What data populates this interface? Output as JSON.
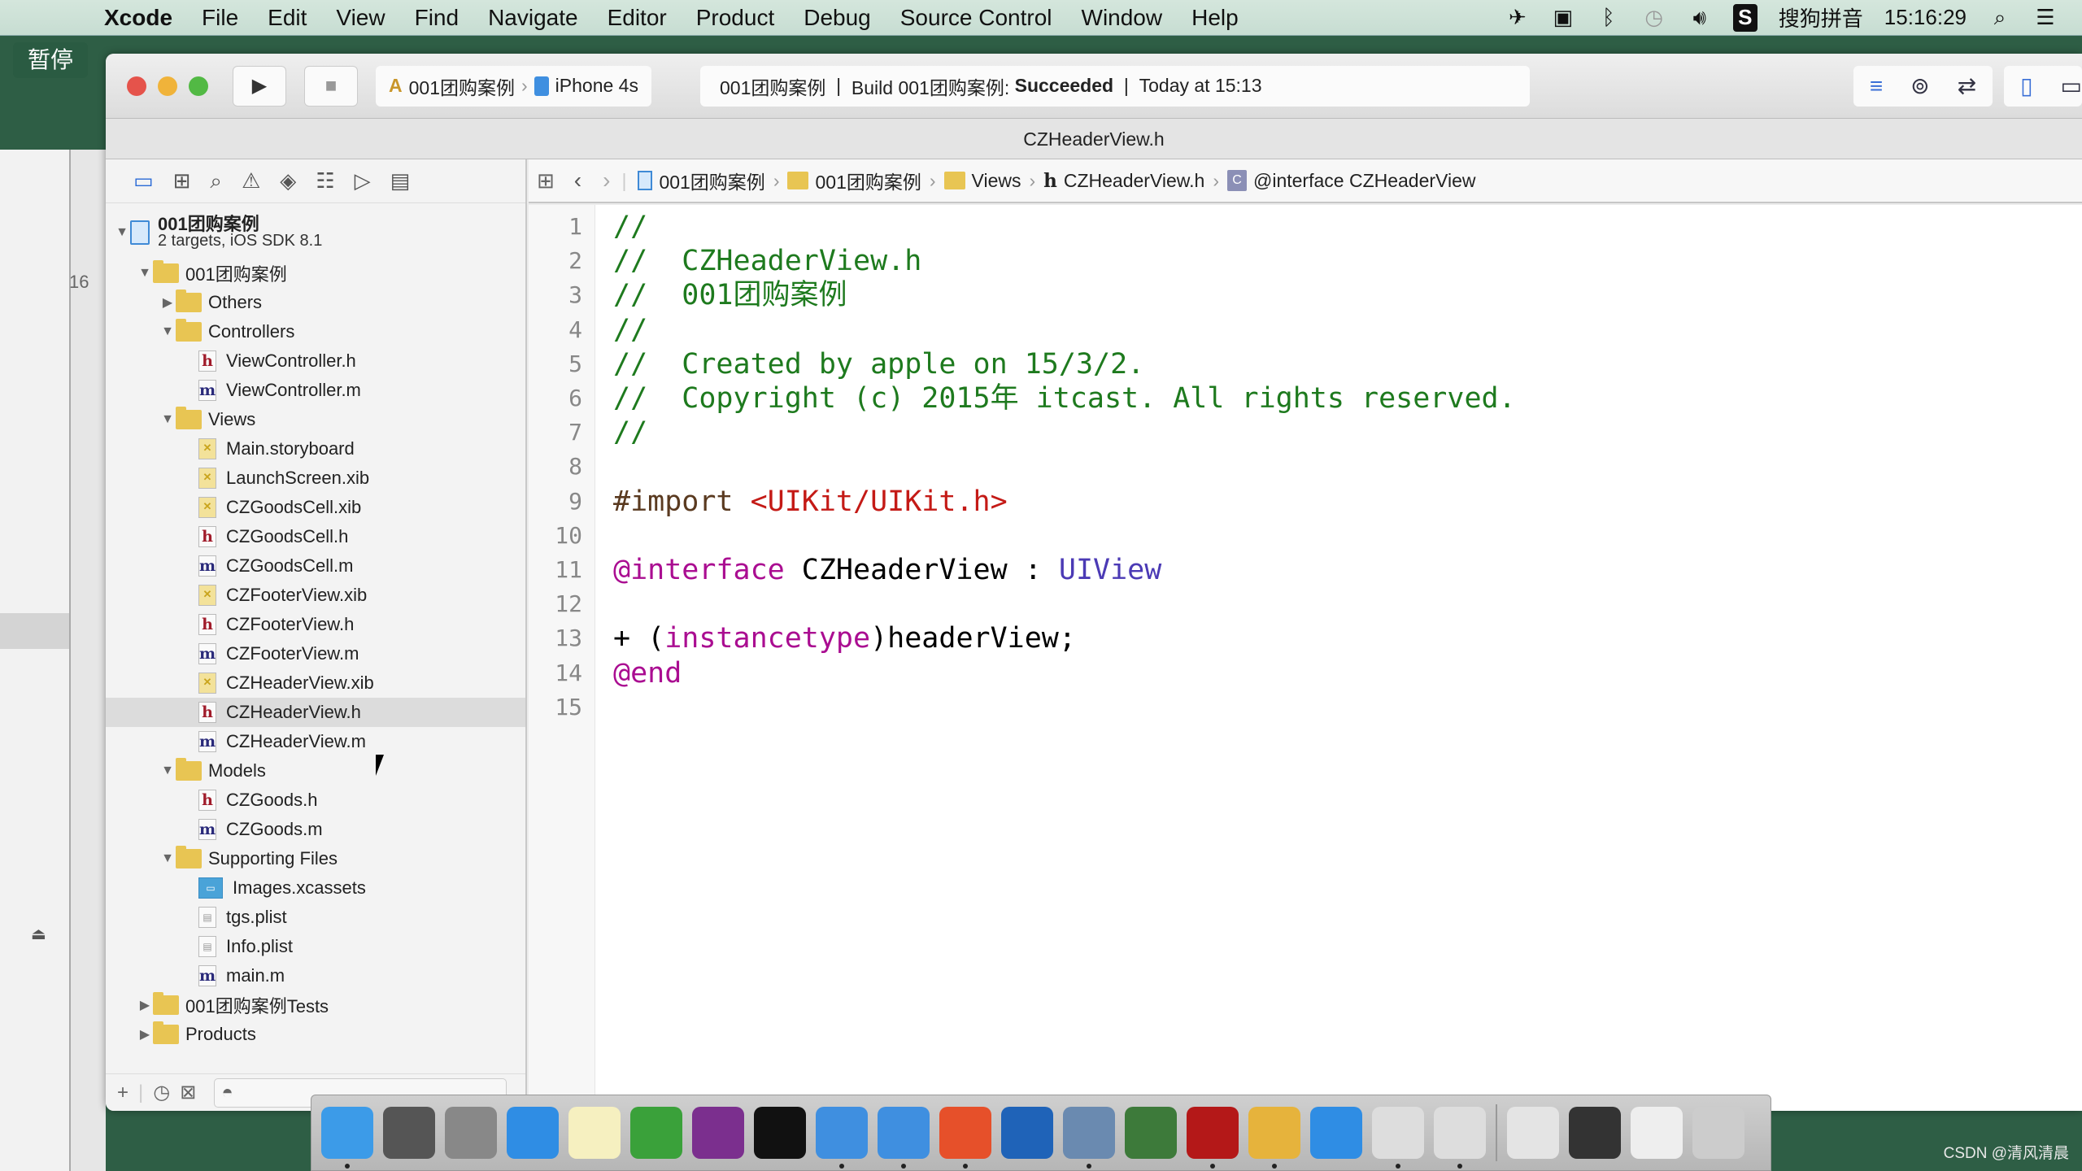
{
  "menubar": {
    "app": "Xcode",
    "items": [
      "File",
      "Edit",
      "View",
      "Find",
      "Navigate",
      "Editor",
      "Product",
      "Debug",
      "Source Control",
      "Window",
      "Help"
    ],
    "input_method": "搜狗拼音",
    "clock": "15:16:29",
    "status_icons": [
      "airplane-icon",
      "screen-record-icon",
      "bluetooth-icon",
      "time-machine-icon",
      "volume-icon",
      "sogou-icon",
      "spotlight-icon",
      "notification-center-icon"
    ]
  },
  "background": {
    "pause_label": "暂停",
    "line_number": "16"
  },
  "toolbar": {
    "scheme": "001团购案例",
    "device": "iPhone 4s",
    "activity": {
      "project": "001团购案例",
      "build_prefix": "Build 001团购案例: ",
      "build_status": "Succeeded",
      "time": "Today at 15:13"
    },
    "colors": {
      "close": "#e5534b",
      "minimize": "#f0b33a",
      "zoom": "#52b944"
    }
  },
  "window_title": "CZHeaderView.h",
  "navigator": {
    "tabs": [
      "project-navigator",
      "symbol-navigator",
      "find-navigator",
      "issue-navigator",
      "test-navigator",
      "debug-navigator",
      "breakpoint-navigator",
      "report-navigator"
    ],
    "project": {
      "name": "001团购案例",
      "subtitle": "2 targets, iOS SDK 8.1"
    },
    "tree": [
      {
        "label": "001团购案例",
        "type": "folder",
        "depth": 1,
        "state": "open"
      },
      {
        "label": "Others",
        "type": "folder",
        "depth": 2,
        "state": "closed"
      },
      {
        "label": "Controllers",
        "type": "folder",
        "depth": 2,
        "state": "open"
      },
      {
        "label": "ViewController.h",
        "type": "h",
        "depth": 3
      },
      {
        "label": "ViewController.m",
        "type": "m",
        "depth": 3
      },
      {
        "label": "Views",
        "type": "folder",
        "depth": 2,
        "state": "open"
      },
      {
        "label": "Main.storyboard",
        "type": "xib",
        "depth": 3
      },
      {
        "label": "LaunchScreen.xib",
        "type": "xib",
        "depth": 3
      },
      {
        "label": "CZGoodsCell.xib",
        "type": "xib",
        "depth": 3
      },
      {
        "label": "CZGoodsCell.h",
        "type": "h",
        "depth": 3
      },
      {
        "label": "CZGoodsCell.m",
        "type": "m",
        "depth": 3
      },
      {
        "label": "CZFooterView.xib",
        "type": "xib",
        "depth": 3
      },
      {
        "label": "CZFooterView.h",
        "type": "h",
        "depth": 3
      },
      {
        "label": "CZFooterView.m",
        "type": "m",
        "depth": 3
      },
      {
        "label": "CZHeaderView.xib",
        "type": "xib",
        "depth": 3
      },
      {
        "label": "CZHeaderView.h",
        "type": "h",
        "depth": 3,
        "selected": true
      },
      {
        "label": "CZHeaderView.m",
        "type": "m",
        "depth": 3
      },
      {
        "label": "Models",
        "type": "folder",
        "depth": 2,
        "state": "open"
      },
      {
        "label": "CZGoods.h",
        "type": "h",
        "depth": 3
      },
      {
        "label": "CZGoods.m",
        "type": "m",
        "depth": 3
      },
      {
        "label": "Supporting Files",
        "type": "folder",
        "depth": 2,
        "state": "open"
      },
      {
        "label": "Images.xcassets",
        "type": "assets",
        "depth": 3
      },
      {
        "label": "tgs.plist",
        "type": "plist",
        "depth": 3
      },
      {
        "label": "Info.plist",
        "type": "plist",
        "depth": 3
      },
      {
        "label": "main.m",
        "type": "m",
        "depth": 3
      },
      {
        "label": "001团购案例Tests",
        "type": "folder",
        "depth": 1,
        "state": "closed"
      },
      {
        "label": "Products",
        "type": "folder",
        "depth": 1,
        "state": "closed"
      }
    ]
  },
  "jumpbar": {
    "crumbs": [
      {
        "label": "001团购案例",
        "icon": "project"
      },
      {
        "label": "001团购案例",
        "icon": "folder"
      },
      {
        "label": "Views",
        "icon": "folder"
      },
      {
        "label": "CZHeaderView.h",
        "icon": "h"
      },
      {
        "label": "@interface CZHeaderView",
        "icon": "class"
      }
    ]
  },
  "editor": {
    "lines": [
      [
        {
          "t": "//",
          "c": "com"
        }
      ],
      [
        {
          "t": "//  CZHeaderView.h",
          "c": "com"
        }
      ],
      [
        {
          "t": "//  001团购案例",
          "c": "com"
        }
      ],
      [
        {
          "t": "//",
          "c": "com"
        }
      ],
      [
        {
          "t": "//  Created by apple on 15/3/2.",
          "c": "com"
        }
      ],
      [
        {
          "t": "//  Copyright (c) 2015年 itcast. All rights reserved.",
          "c": "com"
        }
      ],
      [
        {
          "t": "//",
          "c": "com"
        }
      ],
      [],
      [
        {
          "t": "#import ",
          "c": "pre"
        },
        {
          "t": "<UIKit/UIKit.h>",
          "c": "str"
        }
      ],
      [],
      [
        {
          "t": "@interface",
          "c": "kw"
        },
        {
          "t": " CZHeaderView : ",
          "c": "plain"
        },
        {
          "t": "UIView",
          "c": "cls"
        }
      ],
      [],
      [
        {
          "t": "+ (",
          "c": "plain"
        },
        {
          "t": "instancetype",
          "c": "kw"
        },
        {
          "t": ")headerView;",
          "c": "plain"
        }
      ],
      [
        {
          "t": "@end",
          "c": "kw"
        }
      ],
      []
    ]
  },
  "dock": {
    "apps": [
      {
        "name": "finder",
        "color": "#3c9be8",
        "running": true
      },
      {
        "name": "system-preferences",
        "color": "#555",
        "running": false
      },
      {
        "name": "launchpad",
        "color": "#888",
        "running": false
      },
      {
        "name": "safari",
        "color": "#2f8de4",
        "running": false
      },
      {
        "name": "notes",
        "color": "#f6f0c0",
        "running": false
      },
      {
        "name": "xmind",
        "color": "#3aa13a",
        "running": false
      },
      {
        "name": "onenote",
        "color": "#7b2f8e",
        "running": false
      },
      {
        "name": "terminal",
        "color": "#111",
        "running": false
      },
      {
        "name": "xcode",
        "color": "#3f8fe0",
        "running": true
      },
      {
        "name": "simulator",
        "color": "#3f8fe0",
        "running": true
      },
      {
        "name": "wps-presentation",
        "color": "#e6502a",
        "running": true
      },
      {
        "name": "screenshot-tool",
        "color": "#1f63b8",
        "running": false
      },
      {
        "name": "video-converter",
        "color": "#6a8ab0",
        "running": true
      },
      {
        "name": "ftp-client",
        "color": "#3d7a3a",
        "running": false
      },
      {
        "name": "filezilla",
        "color": "#b41818",
        "running": true
      },
      {
        "name": "sketch-tool",
        "color": "#e6b33c",
        "running": true
      },
      {
        "name": "word",
        "color": "#2f8de4",
        "running": false
      },
      {
        "name": "instruments-a",
        "color": "#ddd",
        "running": true
      },
      {
        "name": "instruments-b",
        "color": "#ddd",
        "running": true
      },
      {
        "name": "downloads-stack",
        "color": "#e4e4e4",
        "running": false
      },
      {
        "name": "desktop-stack",
        "color": "#333",
        "running": false
      },
      {
        "name": "documents-stack",
        "color": "#eee",
        "running": false
      },
      {
        "name": "trash",
        "color": "#ccc",
        "running": false
      }
    ]
  },
  "watermark": "CSDN @清风清晨"
}
